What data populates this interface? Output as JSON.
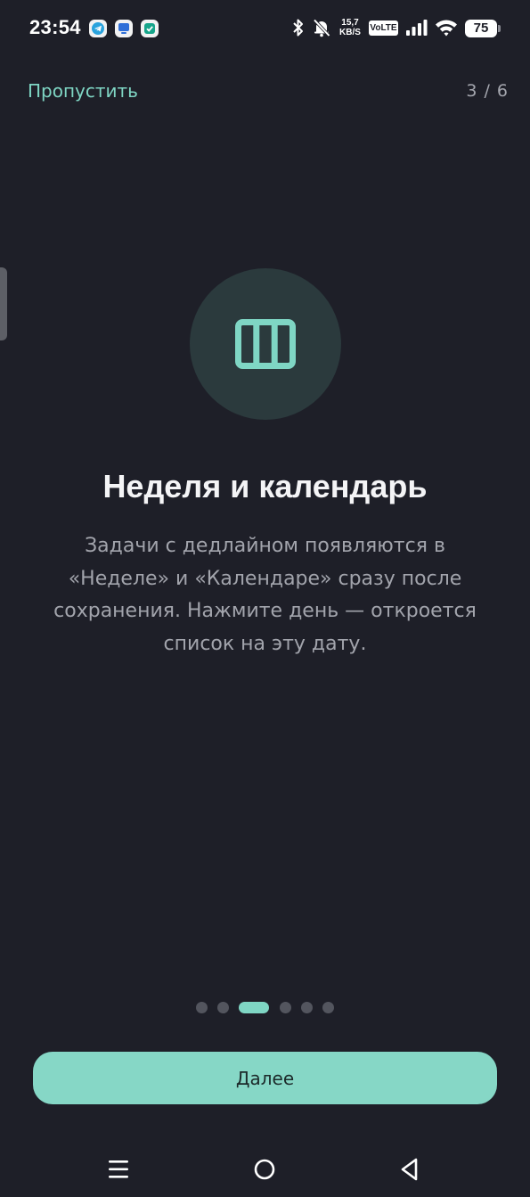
{
  "status_bar": {
    "time": "23:54",
    "network_speed_value": "15,7",
    "network_speed_unit": "KB/S",
    "volte_label": "VoLTE",
    "battery_level": "75",
    "icons": [
      "telegram-icon",
      "app-icon",
      "checklist-icon",
      "bluetooth-icon",
      "bell-muted-icon",
      "signal-icon",
      "wifi-icon",
      "battery-icon"
    ]
  },
  "header": {
    "skip_label": "Пропустить",
    "step_counter": "3 / 6"
  },
  "slide": {
    "icon": "week-columns-icon",
    "title": "Неделя и календарь",
    "description": "Задачи с дедлайном появляются в «Неделе» и «Календаре» сразу после сохранения. Нажмите день — откроется список на эту дату."
  },
  "pagination": {
    "total": 6,
    "current": 3
  },
  "next_button": {
    "label": "Далее"
  },
  "nav_bar": {
    "icons": [
      "menu-icon",
      "home-icon",
      "back-icon"
    ]
  },
  "colors": {
    "background": "#1e1f28",
    "accent": "#7fd6c4",
    "button": "#86d7c6",
    "icon_circle": "#2b3a3d",
    "muted_text": "#a2a4ac"
  }
}
